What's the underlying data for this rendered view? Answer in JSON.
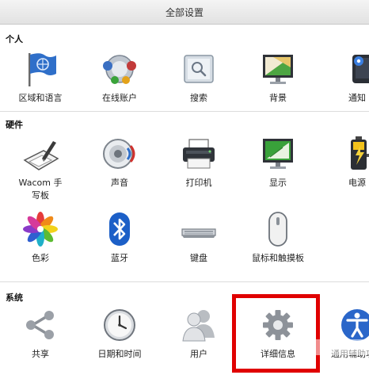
{
  "window": {
    "title": "全部设置"
  },
  "sections": {
    "personal": {
      "title": "个人",
      "items": [
        {
          "label": "区域和语言",
          "icon": "flag-globe-icon"
        },
        {
          "label": "在线账户",
          "icon": "online-accounts-icon"
        },
        {
          "label": "搜索",
          "icon": "search-icon"
        },
        {
          "label": "背景",
          "icon": "monitor-background-icon"
        },
        {
          "label": "通知",
          "icon": "notification-icon"
        }
      ]
    },
    "hardware": {
      "title": "硬件",
      "items": [
        {
          "label": "Wacom 手写板",
          "icon": "tablet-pen-icon"
        },
        {
          "label": "声音",
          "icon": "speaker-icon"
        },
        {
          "label": "打印机",
          "icon": "printer-icon"
        },
        {
          "label": "显示",
          "icon": "display-icon"
        },
        {
          "label": "电源",
          "icon": "battery-icon"
        },
        {
          "label": "色彩",
          "icon": "color-flower-icon"
        },
        {
          "label": "蓝牙",
          "icon": "bluetooth-icon"
        },
        {
          "label": "键盘",
          "icon": "keyboard-icon"
        },
        {
          "label": "鼠标和触摸板",
          "icon": "mouse-icon"
        }
      ]
    },
    "system": {
      "title": "系统",
      "items": [
        {
          "label": "共享",
          "icon": "share-icon"
        },
        {
          "label": "日期和时间",
          "icon": "clock-icon"
        },
        {
          "label": "用户",
          "icon": "users-icon"
        },
        {
          "label": "详细信息",
          "icon": "gear-icon"
        },
        {
          "label": "通用辅助功能",
          "icon": "accessibility-icon"
        }
      ]
    }
  },
  "highlight_color": "#e00000"
}
